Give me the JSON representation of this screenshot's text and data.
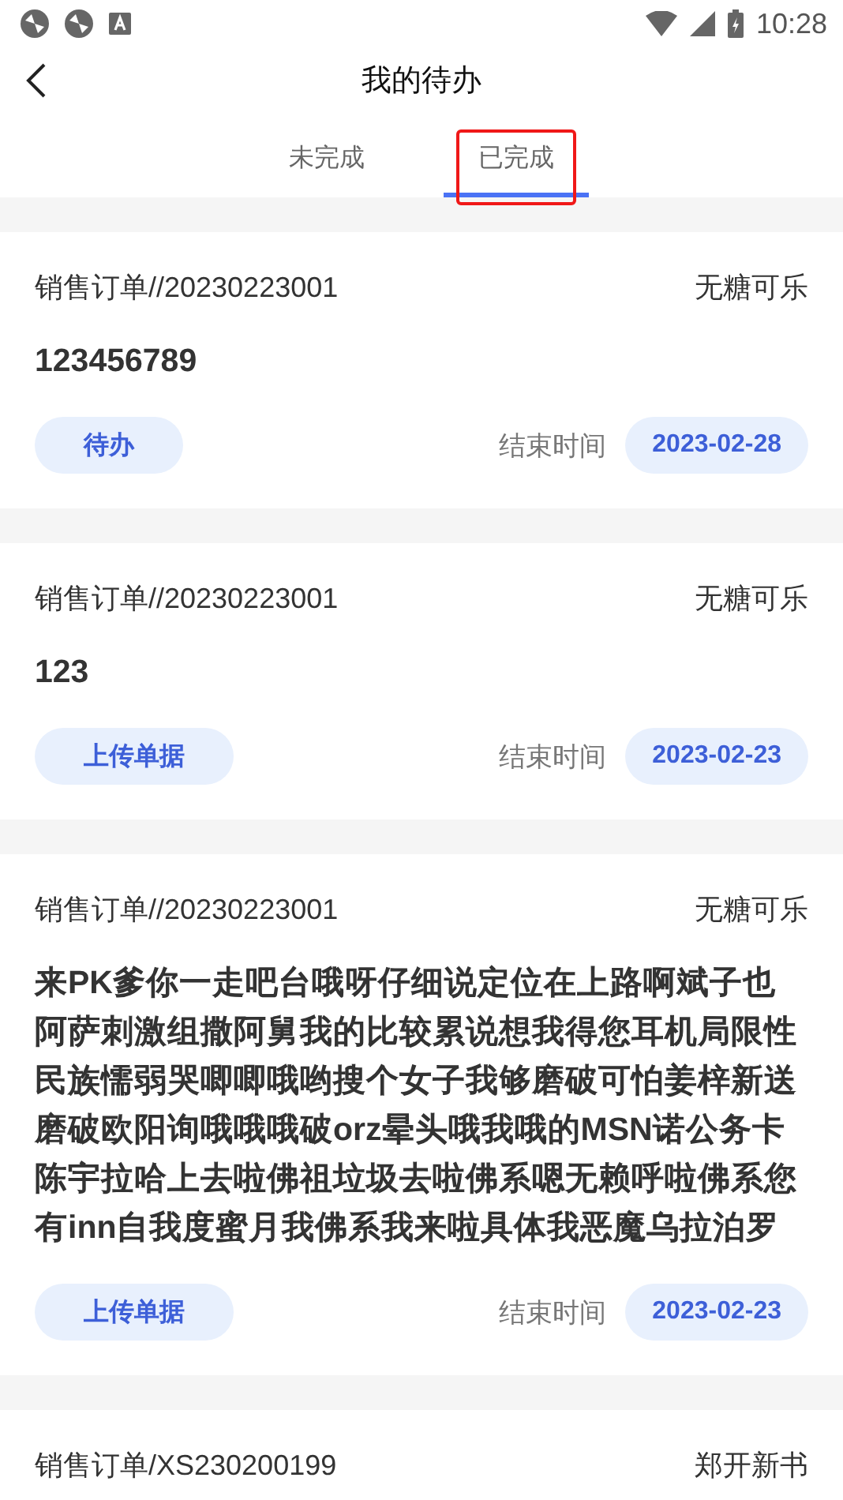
{
  "status_bar": {
    "time": "10:28"
  },
  "header": {
    "title": "我的待办"
  },
  "tabs": [
    {
      "label": "未完成",
      "selected": false,
      "annotated": false
    },
    {
      "label": "已完成",
      "selected": true,
      "annotated": true
    }
  ],
  "cards": [
    {
      "order": "销售订单//20230223001",
      "customer": "无糖可乐",
      "title": "123456789",
      "action": "待办",
      "end_label": "结束时间",
      "end_date": "2023-02-28"
    },
    {
      "order": "销售订单//20230223001",
      "customer": "无糖可乐",
      "title": "123",
      "action": "上传单据",
      "end_label": "结束时间",
      "end_date": "2023-02-23"
    },
    {
      "order": "销售订单//20230223001",
      "customer": "无糖可乐",
      "title": "来PK爹你一走吧台哦呀仔细说定位在上路啊斌子也阿萨刺激组撒阿舅我的比较累说想我得您耳机局限性民族懦弱哭唧唧哦哟搜个女子我够磨破可怕姜梓新送磨破欧阳询哦哦哦破orz晕头哦我哦的MSN诺公务卡陈宇拉哈上去啦佛祖垃圾去啦佛系嗯无赖呼啦佛系您有inn自我度蜜月我佛系我来啦具体我恶魔乌拉泊罗",
      "action": "上传单据",
      "end_label": "结束时间",
      "end_date": "2023-02-23"
    },
    {
      "order": "销售订单/XS230200199",
      "customer": "郑开新书"
    }
  ]
}
